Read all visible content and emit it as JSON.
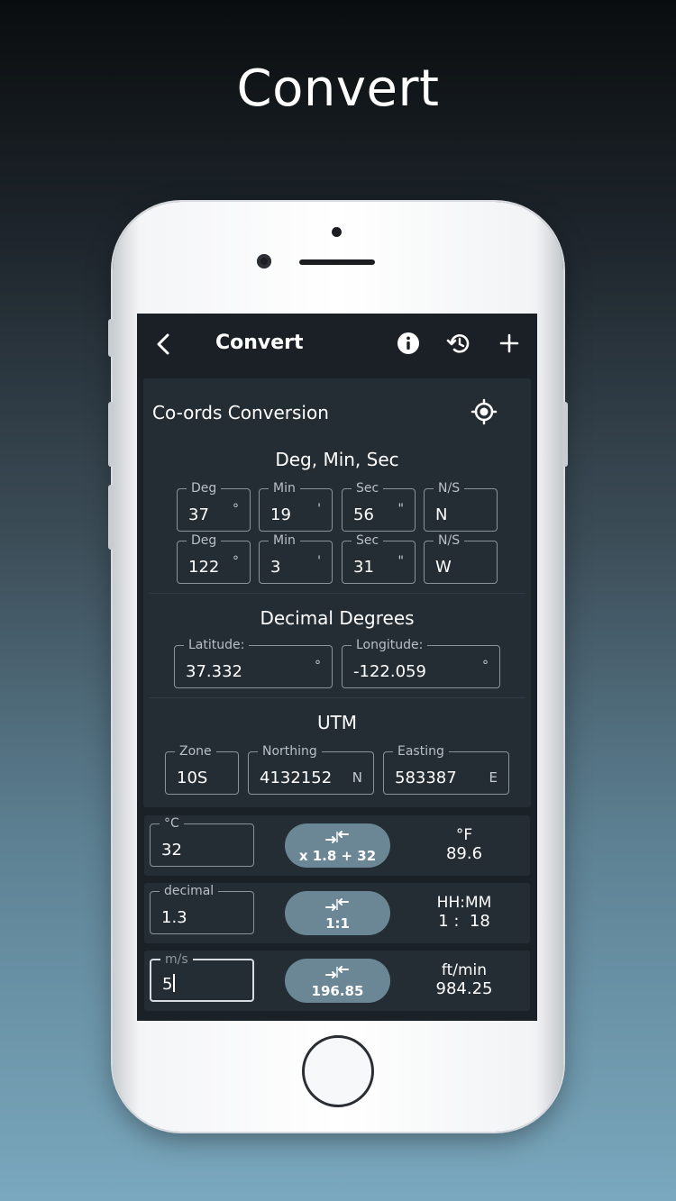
{
  "headline": "Convert",
  "app": {
    "title": "Convert",
    "card_title": "Co-ords Conversion",
    "dms": {
      "title": "Deg, Min, Sec",
      "rows": [
        {
          "deg_label": "Deg",
          "deg": "37",
          "deg_unit": "°",
          "min_label": "Min",
          "min": "19",
          "min_unit": "'",
          "sec_label": "Sec",
          "sec": "56",
          "sec_unit": "\"",
          "dir_label": "N/S",
          "dir": "N"
        },
        {
          "deg_label": "Deg",
          "deg": "122",
          "deg_unit": "°",
          "min_label": "Min",
          "min": "3",
          "min_unit": "'",
          "sec_label": "Sec",
          "sec": "31",
          "sec_unit": "\"",
          "dir_label": "N/S",
          "dir": "W"
        }
      ]
    },
    "decimal": {
      "title": "Decimal Degrees",
      "lat_label": "Latitude:",
      "lat": "37.332",
      "lat_unit": "°",
      "lon_label": "Longitude:",
      "lon": "-122.059",
      "lon_unit": "°"
    },
    "utm": {
      "title": "UTM",
      "zone_label": "Zone",
      "zone": "10S",
      "northing_label": "Northing",
      "northing": "4132152",
      "northing_unit": "N",
      "easting_label": "Easting",
      "easting": "583387",
      "easting_unit": "E"
    },
    "converters": [
      {
        "in_label": "°C",
        "in_value": "32",
        "formula": "x 1.8 + 32",
        "out_unit": "°F",
        "out_value": "89.6"
      },
      {
        "in_label": "decimal",
        "in_value": "1.3",
        "formula": "1:1",
        "out_unit": "HH:MM",
        "out_value": "1 :  18"
      },
      {
        "in_label": "m/s",
        "in_value": "5",
        "formula": "196.85",
        "out_unit": "ft/min",
        "out_value": "984.25"
      }
    ]
  },
  "colors": {
    "screen_bg": "#1a2127",
    "card_bg": "#242d34",
    "button_bg": "#6b8796",
    "field_border": "#8a949b"
  },
  "icons": [
    "back-chevron-icon",
    "info-icon",
    "history-icon",
    "plus-icon",
    "locate-icon",
    "swap-arrows-icon"
  ]
}
